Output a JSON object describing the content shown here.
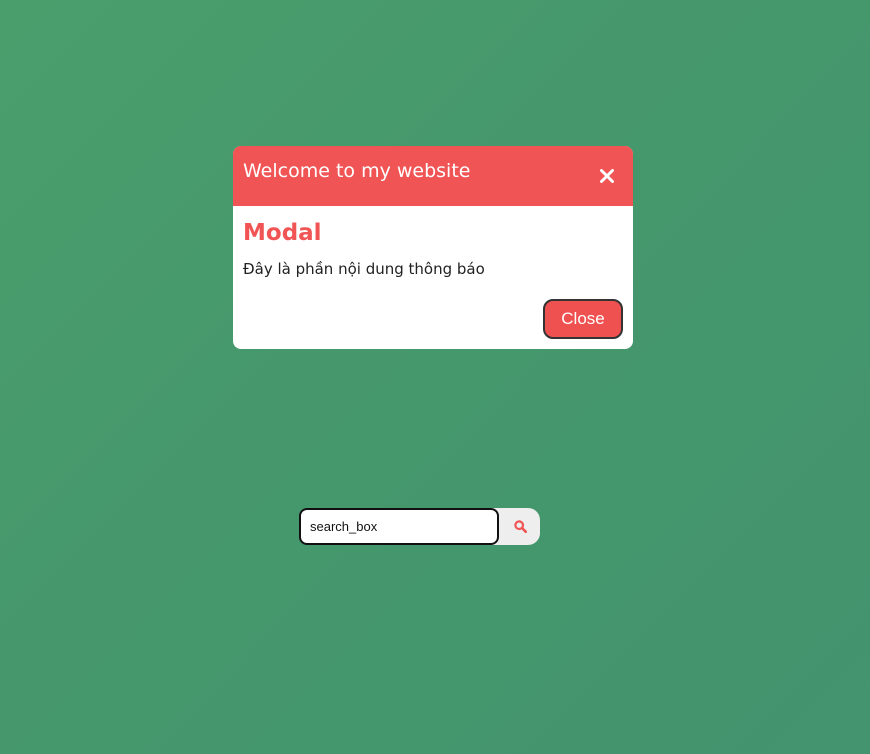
{
  "modal": {
    "title": "Welcome to my website",
    "heading": "Modal",
    "body_text": "Đây là phần nội dung thông báo",
    "close_button_label": "Close",
    "close_icon": "close-x-icon"
  },
  "search": {
    "value": "search_box",
    "icon": "search-icon"
  },
  "colors": {
    "background": "#46996c",
    "modal_accent": "#f05454",
    "modal_body": "#ffffff",
    "text": "#222222"
  }
}
